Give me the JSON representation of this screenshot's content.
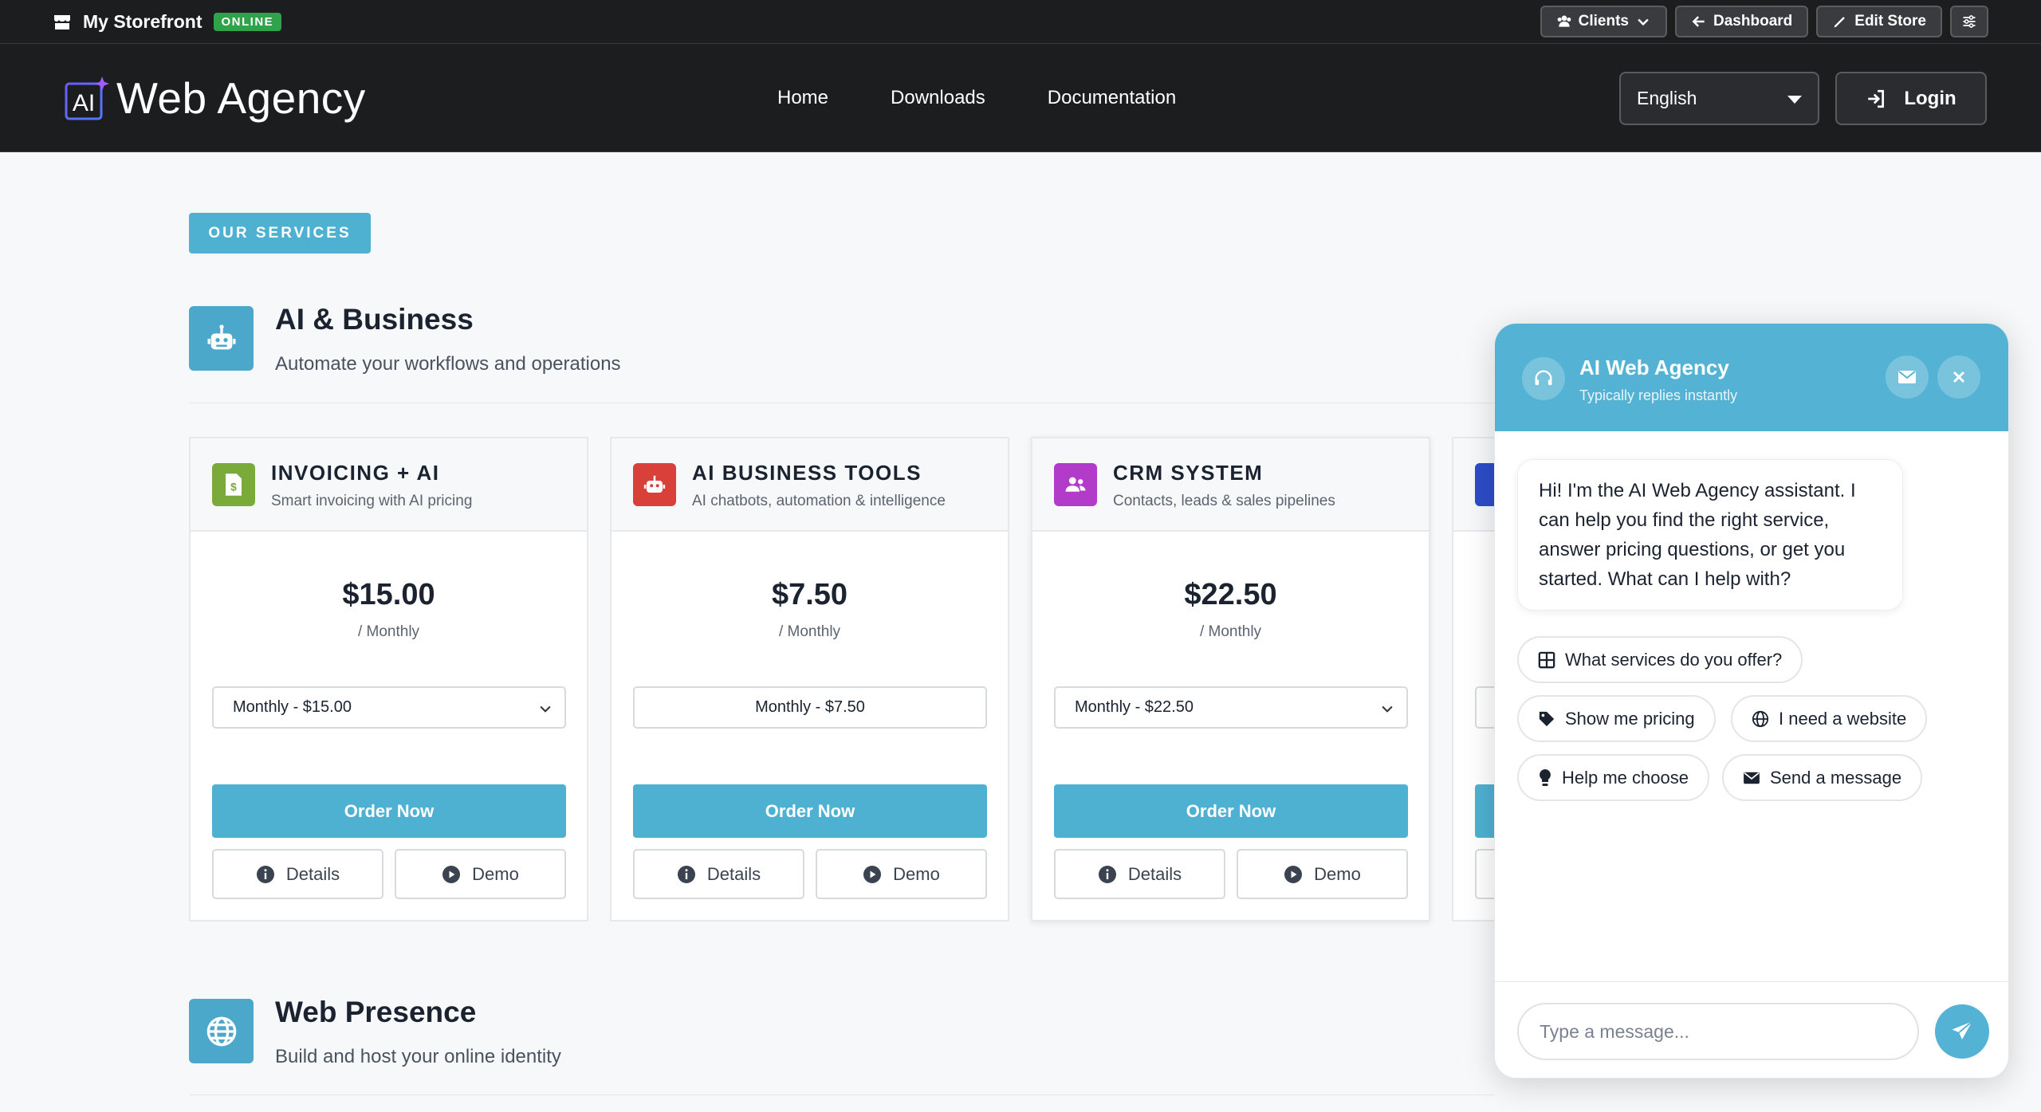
{
  "adminbar": {
    "store_title": "My Storefront",
    "status_badge": "ONLINE",
    "clients_label": "Clients",
    "dashboard_label": "Dashboard",
    "edit_store_label": "Edit Store"
  },
  "header": {
    "logo_mark": "AI",
    "logo_text": "Web Agency",
    "nav": [
      "Home",
      "Downloads",
      "Documentation"
    ],
    "language": "English",
    "login_label": "Login"
  },
  "main": {
    "section_label": "OUR SERVICES",
    "categories": [
      {
        "title": "AI & Business",
        "subtitle": "Automate your workflows and operations"
      },
      {
        "title": "Web Presence",
        "subtitle": "Build and host your online identity"
      }
    ],
    "cards": [
      {
        "title": "INVOICING + AI",
        "subtitle": "Smart invoicing with AI pricing",
        "price": "$15.00",
        "period": "/ Monthly",
        "option": "Monthly - $15.00",
        "order": "Order Now",
        "details": "Details",
        "demo": "Demo",
        "color": "#7aab3a"
      },
      {
        "title": "AI BUSINESS TOOLS",
        "subtitle": "AI chatbots, automation & intelligence",
        "price": "$7.50",
        "period": "/ Monthly",
        "option": "Monthly - $7.50",
        "order": "Order Now",
        "details": "Details",
        "demo": "Demo",
        "color": "#d9403a"
      },
      {
        "title": "CRM SYSTEM",
        "subtitle": "Contacts, leads & sales pipelines",
        "price": "$22.50",
        "period": "/ Monthly",
        "option": "Monthly - $22.50",
        "order": "Order Now",
        "details": "Details",
        "demo": "Demo",
        "color": "#b33bc9"
      }
    ]
  },
  "chat": {
    "name": "AI Web Agency",
    "status": "Typically replies instantly",
    "greeting": "Hi! I'm the AI Web Agency assistant. I can help you find the right service, answer pricing questions, or get you started. What can I help with?",
    "chips": [
      "What services do you offer?",
      "Show me pricing",
      "I need a website",
      "Help me choose",
      "Send a message"
    ],
    "input_placeholder": "Type a message..."
  },
  "colors": {
    "accent": "#4fb1d2",
    "dark": "#1c1d1f",
    "online": "#2fa24a"
  }
}
